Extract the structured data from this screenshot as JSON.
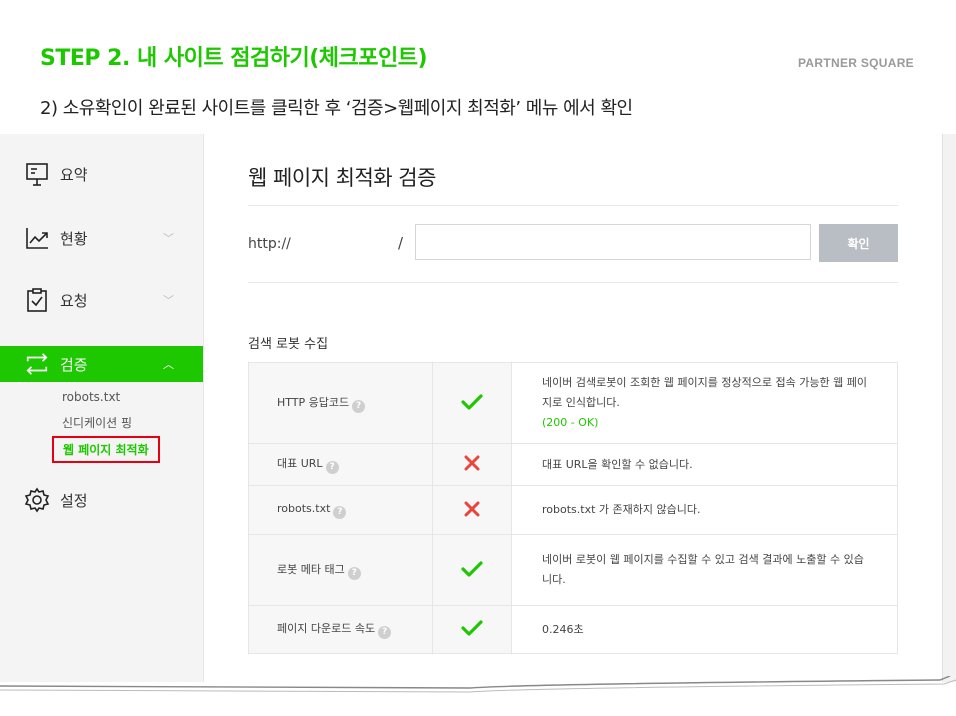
{
  "slide": {
    "step_title": "STEP 2. 내 사이트 점검하기(체크포인트)",
    "brand": "PARTNER SQUARE",
    "instruction": "2) 소유확인이 완료된 사이트를 클릭한 후 ‘검증>웹페이지 최적화’ 메뉴 에서 확인"
  },
  "sidebar": {
    "items": [
      {
        "label": "요약",
        "icon": "summary-board-icon"
      },
      {
        "label": "현황",
        "icon": "trend-chart-icon",
        "chevron": "﹀"
      },
      {
        "label": "요청",
        "icon": "clipboard-check-icon",
        "chevron": "﹀"
      },
      {
        "label": "검증",
        "icon": "swap-arrows-icon",
        "chevron": "︿",
        "active": true
      },
      {
        "label": "설정",
        "icon": "gear-icon"
      }
    ],
    "subitems": [
      "robots.txt",
      "신디케이션 핑",
      "웹 페이지 최적화"
    ]
  },
  "main": {
    "title": "웹 페이지 최적화 검증",
    "url_prefix": "http://",
    "url_sep": "/",
    "url_value": "",
    "confirm_label": "확인",
    "section_title": "검색 로봇 수집",
    "rows": [
      {
        "name": "HTTP 응답코드",
        "status": "pass",
        "message": "네이버 검색로봇이 조회한 웹 페이지를 정상적으로 접속 가능한 웹 페이지로 인식합니다.",
        "detail": "(200 - OK)"
      },
      {
        "name": "대표 URL",
        "status": "fail",
        "message": "대표 URL을 확인할 수 없습니다."
      },
      {
        "name": "robots.txt",
        "status": "fail",
        "message": "robots.txt 가 존재하지 않습니다."
      },
      {
        "name": "로봇 메타 태그",
        "status": "pass",
        "message": "네이버 로봇이 웹 페이지를 수집할 수 있고 검색 결과에 노출할 수 있습니다."
      },
      {
        "name": "페이지 다운로드 속도",
        "status": "pass",
        "message": "0.246초"
      }
    ]
  },
  "colors": {
    "accent": "#1ec800",
    "fail": "#e8463c",
    "highlight_border": "#e60012"
  }
}
